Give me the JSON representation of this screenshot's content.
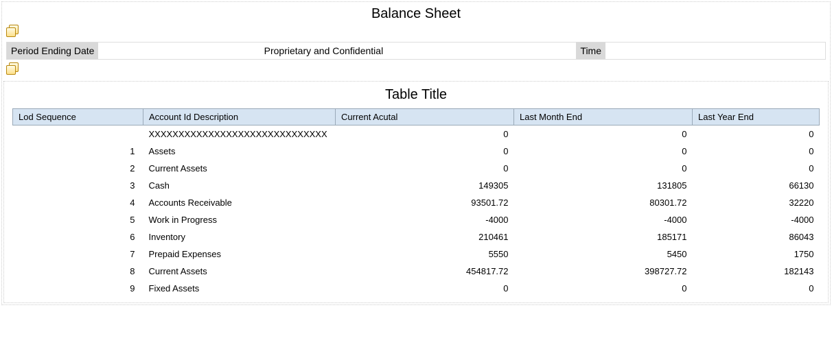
{
  "report_title": "Balance Sheet",
  "header": {
    "period_label": "Period Ending Date",
    "center_label": "Proprietary and Confidential",
    "time_label": "Time"
  },
  "table_title": "Table Title",
  "columns": {
    "lod": "Lod Sequence",
    "desc": "Account Id Description",
    "current": "Current Acutal",
    "last_month": "Last Month End",
    "last_year": "Last Year End"
  },
  "rows": [
    {
      "lod": "",
      "desc": "XXXXXXXXXXXXXXXXXXXXXXXXXXXXXX",
      "current": "0",
      "last_month": "0",
      "last_year": "0"
    },
    {
      "lod": "1",
      "desc": "Assets",
      "current": "0",
      "last_month": "0",
      "last_year": "0"
    },
    {
      "lod": "2",
      "desc": "Current Assets",
      "current": "0",
      "last_month": "0",
      "last_year": "0"
    },
    {
      "lod": "3",
      "desc": "Cash",
      "current": "149305",
      "last_month": "131805",
      "last_year": "66130"
    },
    {
      "lod": "4",
      "desc": "Accounts Receivable",
      "current": "93501.72",
      "last_month": "80301.72",
      "last_year": "32220"
    },
    {
      "lod": "5",
      "desc": "Work in Progress",
      "current": "-4000",
      "last_month": "-4000",
      "last_year": "-4000"
    },
    {
      "lod": "6",
      "desc": "Inventory",
      "current": "210461",
      "last_month": "185171",
      "last_year": "86043"
    },
    {
      "lod": "7",
      "desc": "Prepaid Expenses",
      "current": "5550",
      "last_month": "5450",
      "last_year": "1750"
    },
    {
      "lod": "8",
      "desc": "Current Assets",
      "current": "454817.72",
      "last_month": "398727.72",
      "last_year": "182143"
    },
    {
      "lod": "9",
      "desc": "Fixed Assets",
      "current": "0",
      "last_month": "0",
      "last_year": "0"
    }
  ]
}
